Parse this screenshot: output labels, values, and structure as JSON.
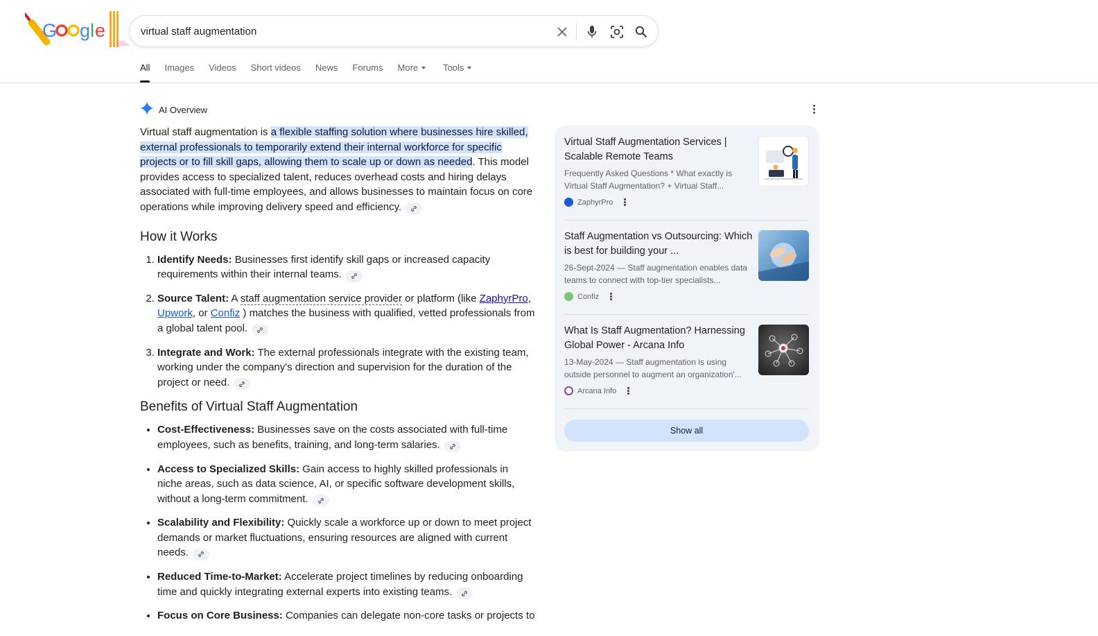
{
  "search": {
    "query": "virtual staff augmentation",
    "icons": [
      "close-icon",
      "microphone-icon",
      "camera-lens-icon",
      "search-icon"
    ]
  },
  "tabs": [
    {
      "label": "All",
      "active": true
    },
    {
      "label": "Images"
    },
    {
      "label": "Videos"
    },
    {
      "label": "Short videos"
    },
    {
      "label": "News"
    },
    {
      "label": "Forums"
    },
    {
      "label": "More"
    },
    {
      "label": "Tools"
    }
  ],
  "ai_overview": {
    "label": "AI Overview",
    "intro_pre": "Virtual staff augmentation is ",
    "intro_highlight": "a flexible staffing solution where businesses hire skilled, external professionals to temporarily extend their internal workforce for specific projects or to fill skill gaps, allowing them to scale up or down as needed",
    "intro_post": ". This model provides access to specialized talent, reduces overhead costs and hiring delays associated with full-time employees, and allows businesses to maintain focus on core operations while improving delivery speed and efficiency.",
    "how_heading": "How it Works",
    "how": [
      {
        "term": "Identify Needs:",
        "text": " Businesses first identify skill gaps or increased capacity requirements within their internal teams."
      },
      {
        "term": "Source Talent:",
        "pre": " A ",
        "link1": "staff augmentation service provider",
        "mid": " or platform (like ",
        "link2": "ZaphyrPro",
        "c1": ", ",
        "link3": "Upwork",
        "c2": ", or ",
        "link4": "Confiz",
        "post": " ) matches the business with qualified, vetted professionals from a global talent pool."
      },
      {
        "term": "Integrate and Work:",
        "text": " The external professionals integrate with the existing team, working under the company's direction and supervision for the duration of the project or need."
      }
    ],
    "benefits_heading": "Benefits of Virtual Staff Augmentation",
    "benefits": [
      {
        "term": "Cost-Effectiveness:",
        "text": " Businesses save on the costs associated with full-time employees, such as benefits, training, and long-term salaries."
      },
      {
        "term": "Access to Specialized Skills:",
        "text": " Gain access to highly skilled professionals in niche areas, such as data science, AI, or specific software development skills, without a long-term commitment."
      },
      {
        "term": "Scalability and Flexibility:",
        "text": " Quickly scale a workforce up or down to meet project demands or market fluctuations, ensuring resources are aligned with current needs."
      },
      {
        "term": "Reduced Time-to-Market:",
        "text": " Accelerate project timelines by reducing onboarding time and quickly integrating external experts into existing teams."
      },
      {
        "term": "Focus on Core Business:",
        "text": " Companies can delegate non-core tasks or projects to"
      }
    ]
  },
  "sources": [
    {
      "title": "Virtual Staff Augmentation Services | Scalable Remote Teams",
      "snippet": "Frequently Asked Questions * What exactly is Virtual Staff Augmentation? + Virtual Staff...",
      "site": "ZaphyrPro"
    },
    {
      "title": "Staff Augmentation vs Outsourcing: Which is best for building your ...",
      "snippet": "26-Sept-2024 — Staff augmentation enables data teams to connect with top-tier specialists...",
      "site": "Confiz"
    },
    {
      "title": "What Is Staff Augmentation? Harnessing Global Power - Arcana Info",
      "snippet": "13-May-2024 — Staff augmentation is using outside personnel to augment an organization'...",
      "site": "Arcana Info"
    }
  ],
  "show_all": "Show all",
  "colors": {
    "link_visited": "#1a0dab",
    "link": "#1558d6",
    "highlight": "#d3e3fd",
    "panel": "#f0f4f9"
  }
}
